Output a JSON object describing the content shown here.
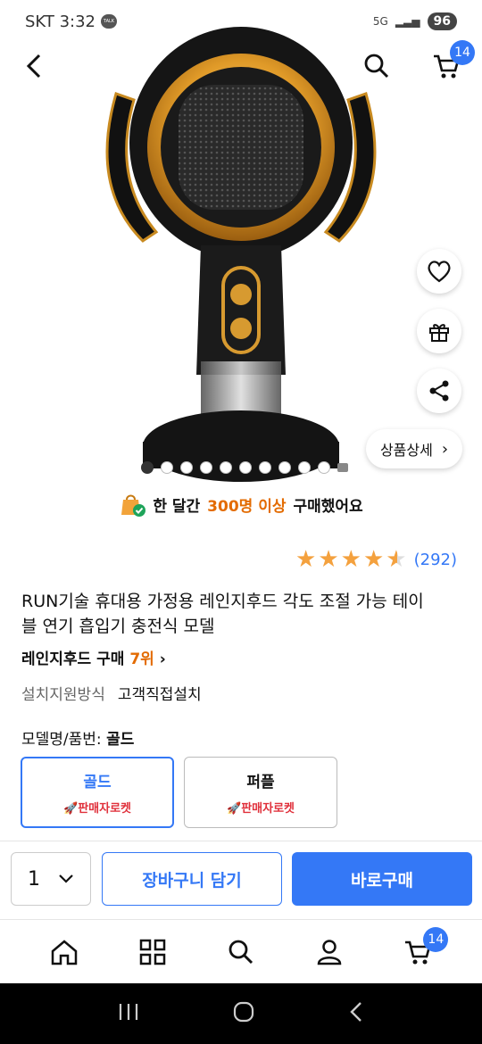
{
  "status_bar": {
    "carrier": "SKT",
    "time": "3:32",
    "talk": "TALK",
    "network": "5G",
    "battery": "96"
  },
  "header": {
    "cart_count": "14"
  },
  "hero": {
    "detail_label": "상품상세",
    "slide_count": 10,
    "active_slide": 0
  },
  "purchase": {
    "prefix": "한 달간",
    "highlight": "300명 이상",
    "suffix": "구매했어요"
  },
  "rating": {
    "stars": 4.5,
    "count": "(292)"
  },
  "product": {
    "title": "RUN기술 휴대용 가정용 레인지후드 각도 조절 가능 테이블 연기 흡입기 충전식 모델",
    "rank_prefix": "레인지후드 구매",
    "rank_num": "7위",
    "install_key": "설치지원방식",
    "install_value": "고객직접설치",
    "model_key": "모델명/품번:",
    "model_value": "골드"
  },
  "options": [
    {
      "name": "골드",
      "badge": "판매자로켓",
      "selected": true
    },
    {
      "name": "퍼플",
      "badge": "판매자로켓",
      "selected": false
    }
  ],
  "action_bar": {
    "quantity": "1",
    "cart_label": "장바구니 담기",
    "buy_label": "바로구매"
  },
  "bottom_nav": {
    "cart_count": "14"
  },
  "colors": {
    "accent": "#3478f6",
    "highlight": "#e36b00",
    "rocket": "#e0303b",
    "star": "#f4a13e"
  }
}
